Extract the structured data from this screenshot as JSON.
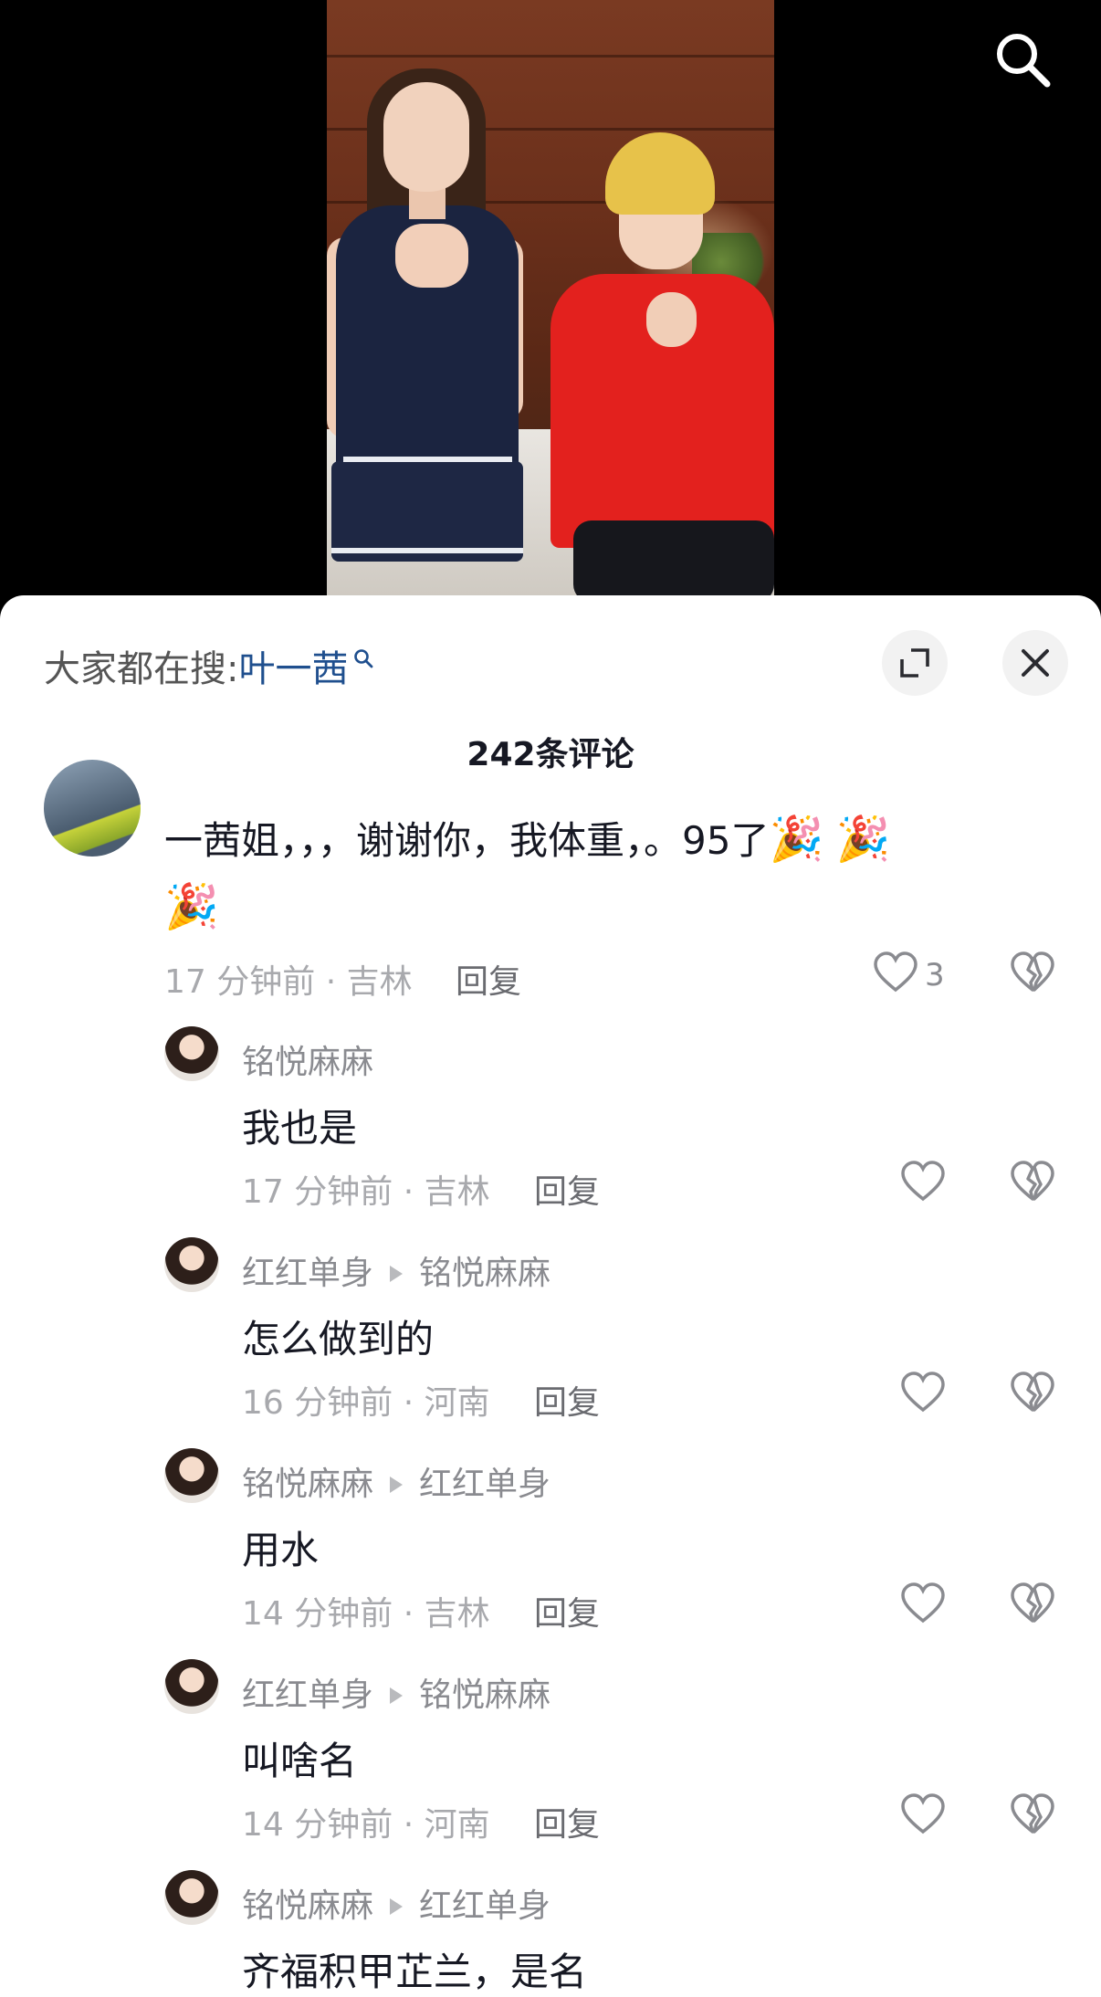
{
  "sheet": {
    "search_prefix": "大家都在搜:",
    "search_keyword": "叶一茜",
    "comment_count_title": "242条评论",
    "icons": {
      "expand": "expand-icon",
      "close": "close-icon",
      "search": "search-icon"
    }
  },
  "main_comment": {
    "text": "一茜姐，，，谢谢你，我体重，。95了",
    "emoji": "🎉",
    "time": "17 分钟前",
    "location": "吉林",
    "reply_label": "回复",
    "likes": "3"
  },
  "replies": [
    {
      "user": "铭悦麻麻",
      "to": "",
      "text": "我也是",
      "time": "17 分钟前",
      "location": "吉林",
      "reply_label": "回复"
    },
    {
      "user": "红红单身",
      "to": "铭悦麻麻",
      "text": "怎么做到的",
      "time": "16 分钟前",
      "location": "河南",
      "reply_label": "回复"
    },
    {
      "user": "铭悦麻麻",
      "to": "红红单身",
      "text": "用水",
      "time": "14 分钟前",
      "location": "吉林",
      "reply_label": "回复"
    },
    {
      "user": "红红单身",
      "to": "铭悦麻麻",
      "text": "叫啥名",
      "time": "14 分钟前",
      "location": "河南",
      "reply_label": "回复"
    },
    {
      "user": "铭悦麻麻",
      "to": "红红单身",
      "text": "齐福积甲芷兰，是名",
      "time": "",
      "location": "",
      "reply_label": ""
    }
  ],
  "meta_separator": " · "
}
